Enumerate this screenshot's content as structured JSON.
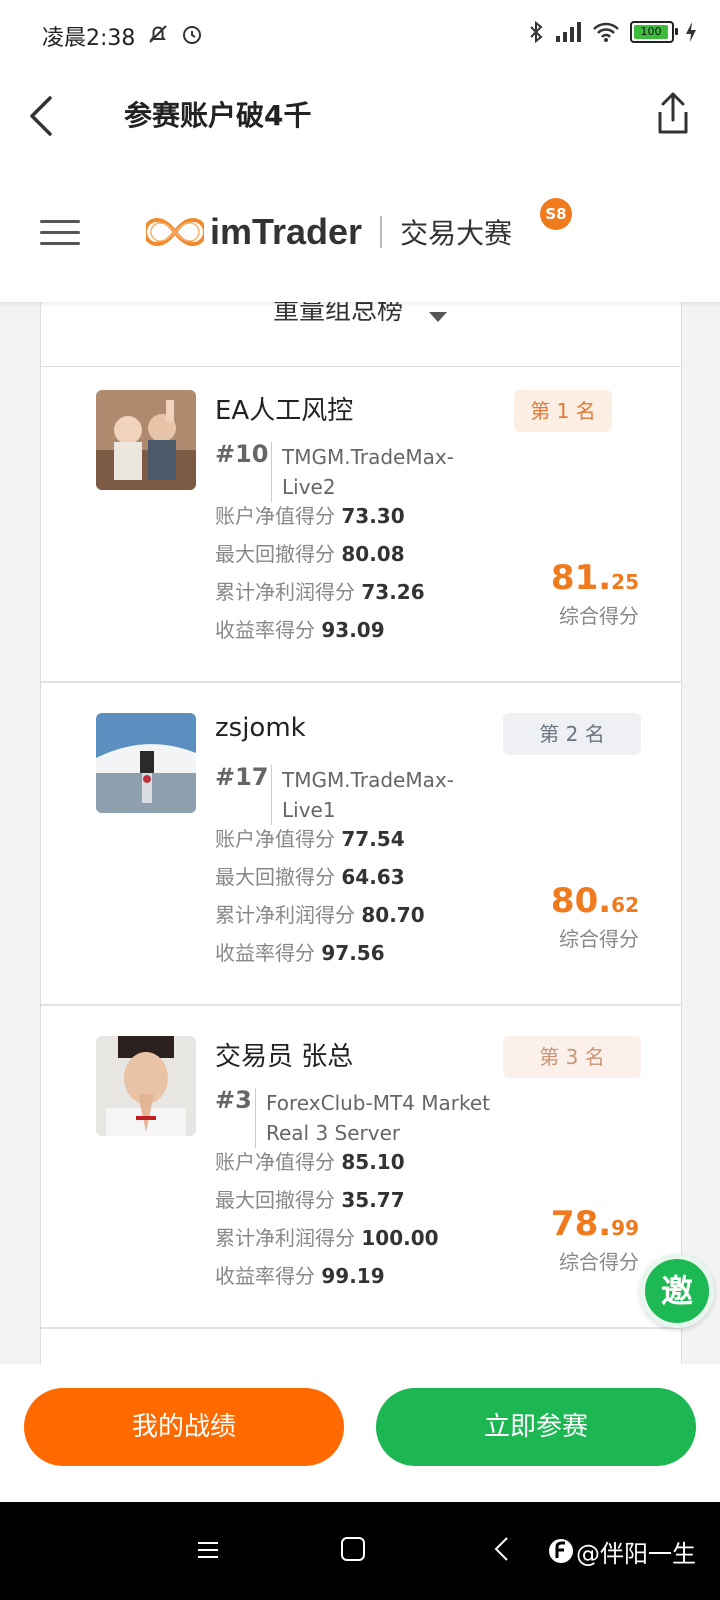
{
  "status_bar": {
    "time": "凌晨2:38",
    "battery": "100"
  },
  "nav": {
    "title": "参赛账户破4千"
  },
  "brand": {
    "name": "imTrader",
    "event": "交易大赛",
    "season": "S8"
  },
  "group": {
    "title": "重量组总榜"
  },
  "labels": {
    "equity": "账户净值得分",
    "drawdown": "最大回撤得分",
    "profit": "累计净利润得分",
    "return": "收益率得分",
    "composite": "综合得分"
  },
  "entries": [
    {
      "name": "EA人工风控",
      "number": "#10",
      "server": "TMGM.TradeMax-Live2",
      "equity": "73.30",
      "drawdown": "80.08",
      "profit": "73.26",
      "return": "93.09",
      "score_int": "81.",
      "score_dec": "25",
      "rank": "第 1 名"
    },
    {
      "name": "zsjomk",
      "number": "#17",
      "server": "TMGM.TradeMax-Live1",
      "equity": "77.54",
      "drawdown": "64.63",
      "profit": "80.70",
      "return": "97.56",
      "score_int": "80.",
      "score_dec": "62",
      "rank": "第 2 名"
    },
    {
      "name": "交易员 张总",
      "number": "#3",
      "server": "ForexClub-MT4 Market Real 3 Server",
      "equity": "85.10",
      "drawdown": "35.77",
      "profit": "100.00",
      "return": "99.19",
      "score_int": "78.",
      "score_dec": "99",
      "rank": "第 3 名"
    }
  ],
  "invite": "邀",
  "buttons": {
    "my_record": "我的战绩",
    "join_now": "立即参赛"
  },
  "watermark": "@伴阳一生",
  "colors": {
    "accent_orange": "#ff6a00",
    "accent_green": "#1cb653",
    "score_orange": "#f07a1e"
  }
}
